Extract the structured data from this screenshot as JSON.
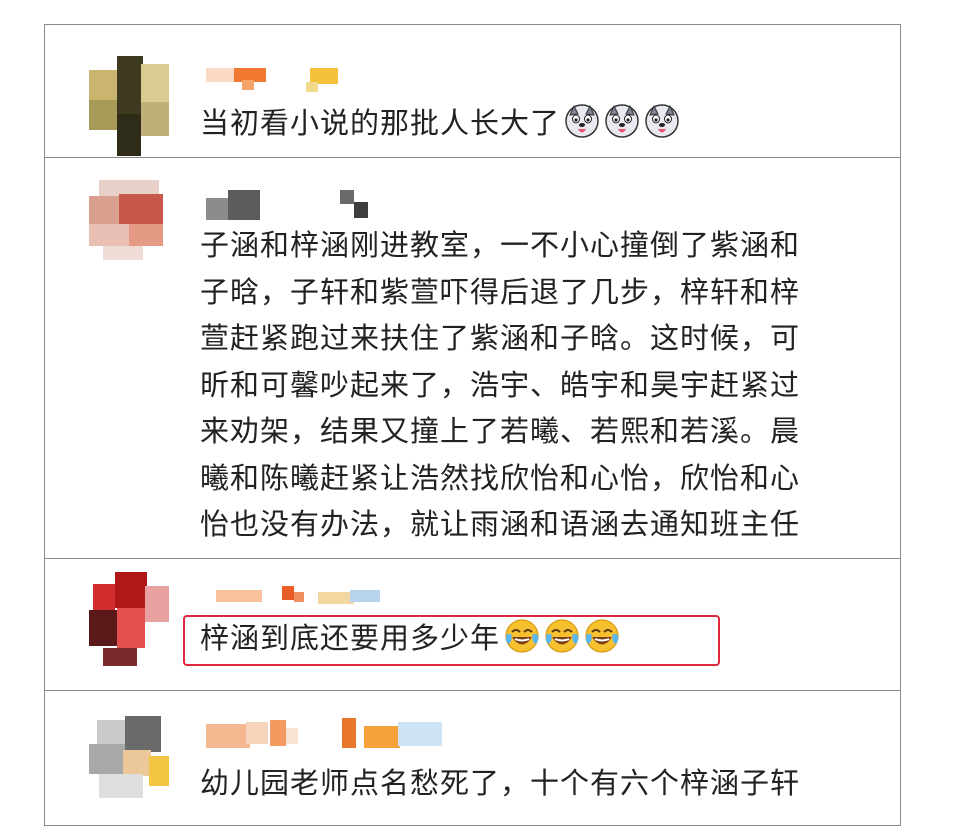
{
  "comments": [
    {
      "text": "当初看小说的那批人长大了",
      "emoji": [
        "husky-emoji",
        "husky-emoji",
        "husky-emoji"
      ]
    },
    {
      "lines": [
        "子涵和梓涵刚进教室，一不小心撞倒了紫涵和",
        "子晗，子轩和紫萱吓得后退了几步，梓轩和梓",
        "萱赶紧跑过来扶住了紫涵和子晗。这时候，可",
        "昕和可馨吵起来了，浩宇、皓宇和昊宇赶紧过",
        "来劝架，结果又撞上了若曦、若熙和若溪。晨",
        "曦和陈曦赶紧让浩然找欣怡和心怡，欣怡和心",
        "怡也没有办法，就让雨涵和语涵去通知班主任"
      ]
    },
    {
      "text": "梓涵到底还要用多少年",
      "emoji": [
        "laugh-cry-emoji",
        "laugh-cry-emoji",
        "laugh-cry-emoji"
      ]
    },
    {
      "text": "幼儿园老师点名愁死了，十个有六个梓涵子轩"
    }
  ],
  "colors": {
    "highlight": "#e0283c",
    "divider": "#8a8a8a",
    "text": "#222222"
  }
}
